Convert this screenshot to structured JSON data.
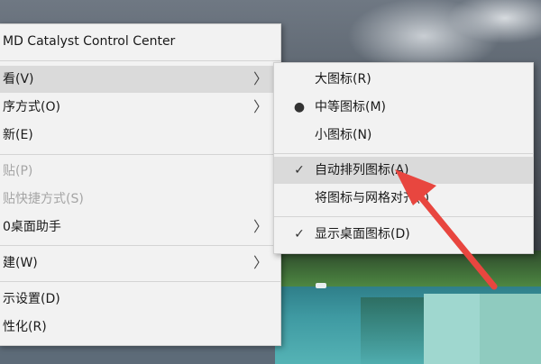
{
  "context_menu": {
    "items": [
      {
        "label": "MD Catalyst Control Center"
      },
      {
        "label": "看(V)"
      },
      {
        "label": "序方式(O)"
      },
      {
        "label": "新(E)"
      },
      {
        "label": "贴(P)"
      },
      {
        "label": "贴快捷方式(S)"
      },
      {
        "label": "0桌面助手"
      },
      {
        "label": "建(W)"
      },
      {
        "label": "示设置(D)"
      },
      {
        "label": "性化(R)"
      }
    ]
  },
  "view_submenu": {
    "items": [
      {
        "label": "大图标(R)",
        "mark": ""
      },
      {
        "label": "中等图标(M)",
        "mark": "●"
      },
      {
        "label": "小图标(N)",
        "mark": ""
      },
      {
        "label": "自动排列图标(A)",
        "mark": "✓"
      },
      {
        "label": "将图标与网格对齐(I)",
        "mark": ""
      },
      {
        "label": "显示桌面图标(D)",
        "mark": "✓"
      }
    ]
  },
  "glyphs": {
    "submenu_arrow": "〉"
  },
  "colors": {
    "annotation_arrow": "#e8463f",
    "highlight": "#dadada"
  }
}
